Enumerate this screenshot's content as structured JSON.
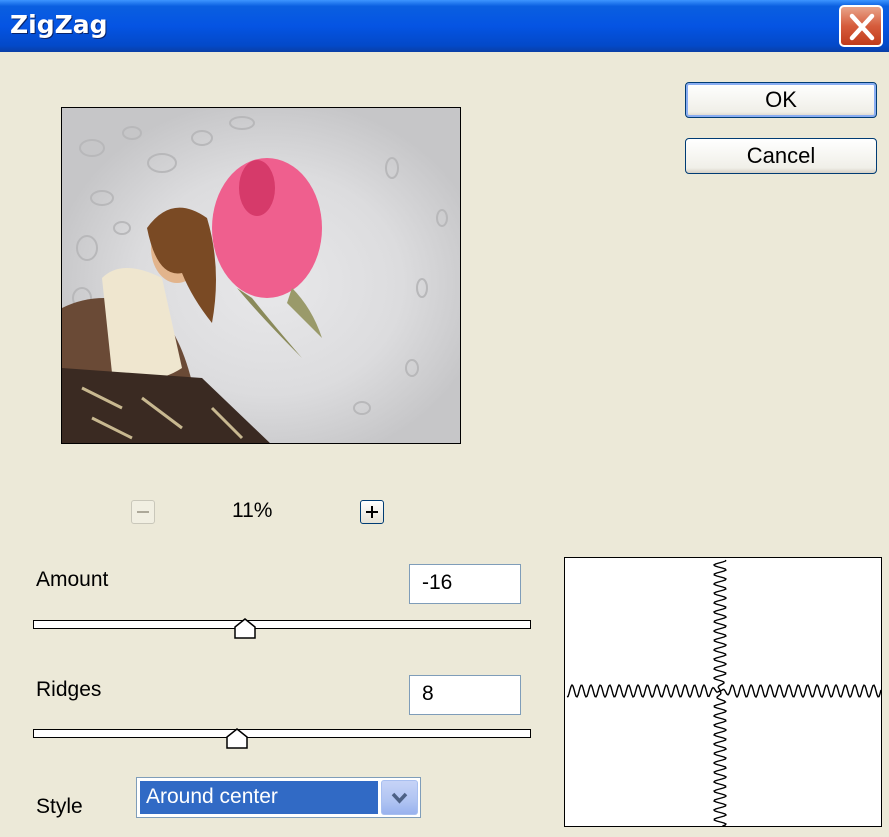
{
  "window": {
    "title": "ZigZag"
  },
  "buttons": {
    "ok": "OK",
    "cancel": "Cancel"
  },
  "zoom": {
    "value": "11%",
    "minus_icon": "minus-icon",
    "plus_icon": "plus-icon"
  },
  "amount": {
    "label": "Amount",
    "value": "-16",
    "slider_fraction": 0.43
  },
  "ridges": {
    "label": "Ridges",
    "value": "8",
    "slider_fraction": 0.41
  },
  "style": {
    "label": "Style",
    "selected": "Around center"
  },
  "colors": {
    "title_bar": "#0554e3",
    "dialog_bg": "#ece9d8",
    "selection": "#316ac5",
    "close_button": "#d65c3c"
  }
}
